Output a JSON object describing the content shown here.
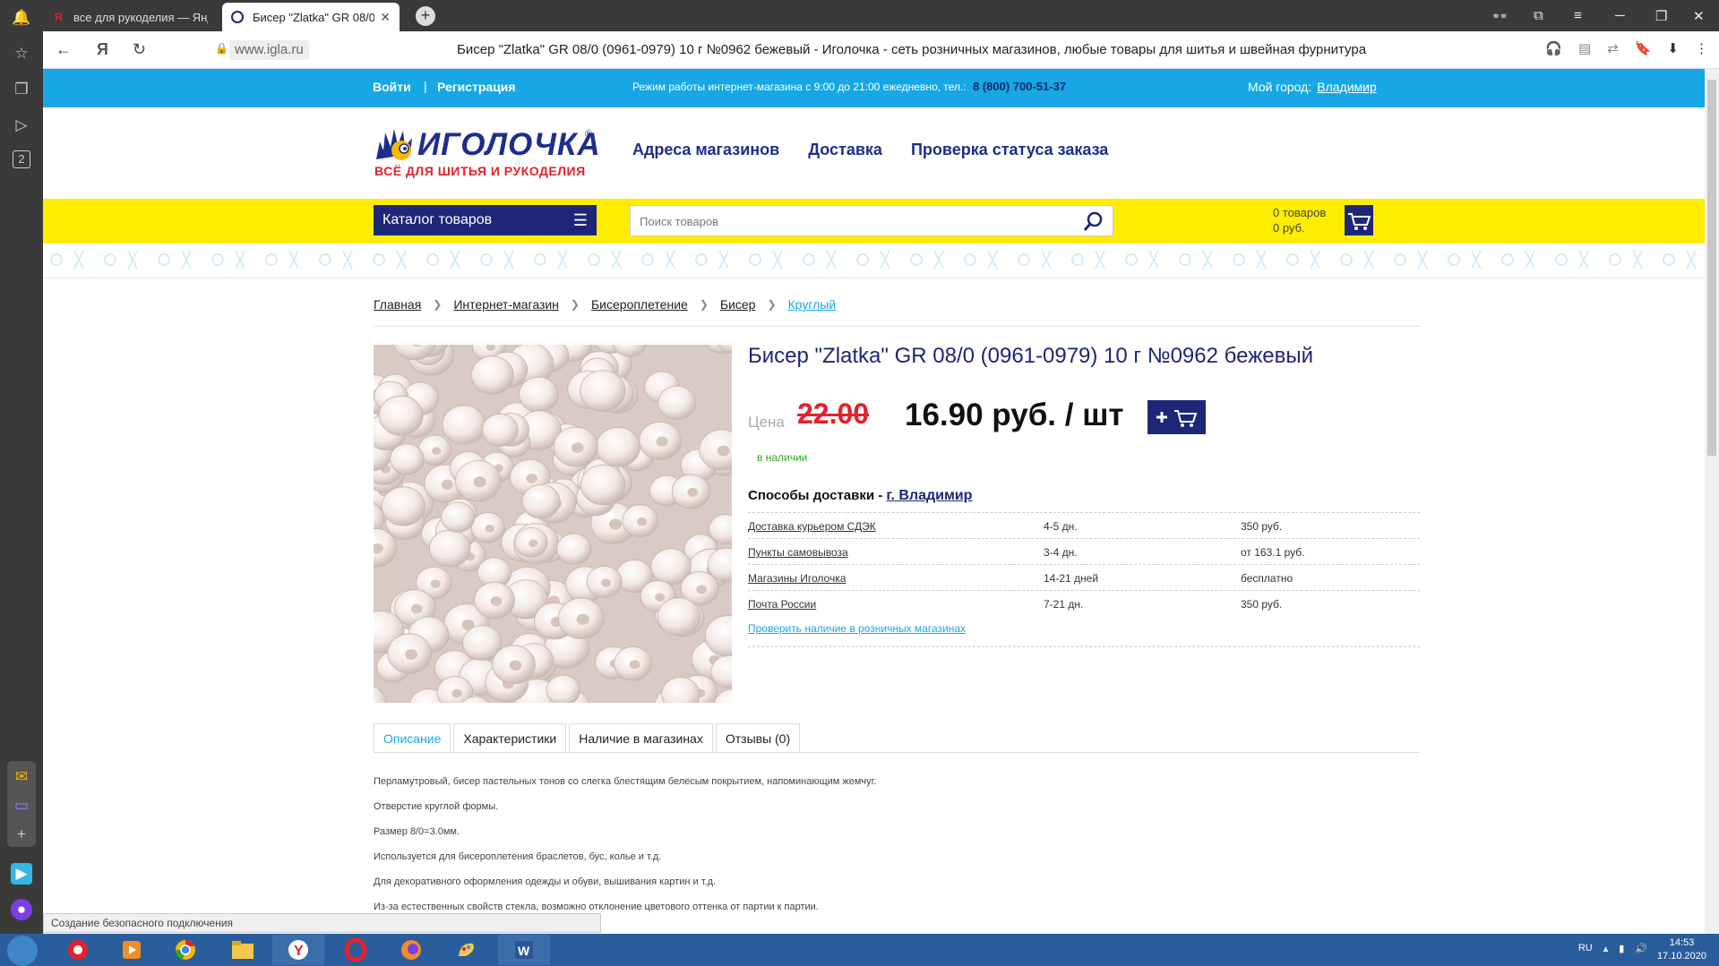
{
  "browser": {
    "tabs": [
      {
        "title": "все для рукоделия — Янд"
      },
      {
        "title": "Бисер \"Zlatka\" GR 08/0",
        "close": "✕"
      }
    ],
    "newtab": "+",
    "url": "www.igla.ru",
    "page_title": "Бисер \"Zlatka\" GR 08/0 (0961-0979) 10 г №0962 бежевый - Иголочка - сеть розничных магазинов, любые товары для шитья и швейная фурнитура",
    "sidebar_badge": "2"
  },
  "site": {
    "top": {
      "login": "Войти",
      "register": "Регистрация",
      "hours": "Режим работы интернет-магазина с 9:00 до 21:00 ежедневно, тел.:",
      "phone": "8 (800) 700-51-37",
      "city_label": "Мой город:",
      "city": "Владимир"
    },
    "logo": {
      "brand": "ИГОЛОЧКА",
      "reg": "®",
      "slogan": "ВСЁ ДЛЯ ШИТЬЯ И РУКОДЕЛИЯ"
    },
    "nav": [
      "Адреса магазинов",
      "Доставка",
      "Проверка статуса заказа"
    ],
    "catalog": "Каталог товаров",
    "search_placeholder": "Поиск товаров",
    "cart": {
      "items": "0 товаров",
      "sum": "0 руб."
    },
    "breadcrumbs": [
      "Главная",
      "Интернет-магазин",
      "Бисероплетение",
      "Бисер",
      "Круглый"
    ]
  },
  "product": {
    "title": "Бисер \"Zlatka\" GR 08/0 (0961-0979) 10 г №0962 бежевый",
    "price_label": "Цена",
    "old_price": "22.00",
    "new_price": "16.90 руб. / шт",
    "stock": "в наличии",
    "delivery_title": "Способы доставки -",
    "delivery_city": "г. Владимир",
    "delivery": [
      {
        "method": "Доставка курьером СДЭК",
        "time": "4-5 дн.",
        "price": "350 руб."
      },
      {
        "method": "Пункты самовывоза",
        "time": "3-4 дн.",
        "price": "от 163.1 руб."
      },
      {
        "method": "Магазины Иголочка",
        "time": "14-21 дней",
        "price": "бесплатно"
      },
      {
        "method": "Почта России",
        "time": "7-21 дн.",
        "price": "350 руб."
      }
    ],
    "check_link": "Проверить наличие в розничных магазинах",
    "tabs": [
      "Описание",
      "Характеристики",
      "Наличие в магазинах",
      "Отзывы (0)"
    ],
    "description": [
      "Перламутровый, бисер пастельных тонов со слегка блестящим белесым покрытием, напоминающим жемчуг.",
      "Отверстие круглой формы.",
      "Размер 8/0=3.0мм.",
      "Используется для бисероплетения браслетов, бус, колье и т.д.",
      "Для декоративного оформления одежды и обуви, вышивания картин и т.д.",
      "Из-за естественных свойств стекла, возможно отклонение цветового оттенка от партии к партии."
    ]
  },
  "status": "Создание безопасного подключения",
  "taskbar": {
    "lang": "RU",
    "time": "14:53",
    "date": "17.10.2020"
  },
  "colors": {
    "accent_blue": "#17a7e4",
    "navy": "#1e2677",
    "yellow": "#ffed00",
    "red": "#e3222c"
  }
}
